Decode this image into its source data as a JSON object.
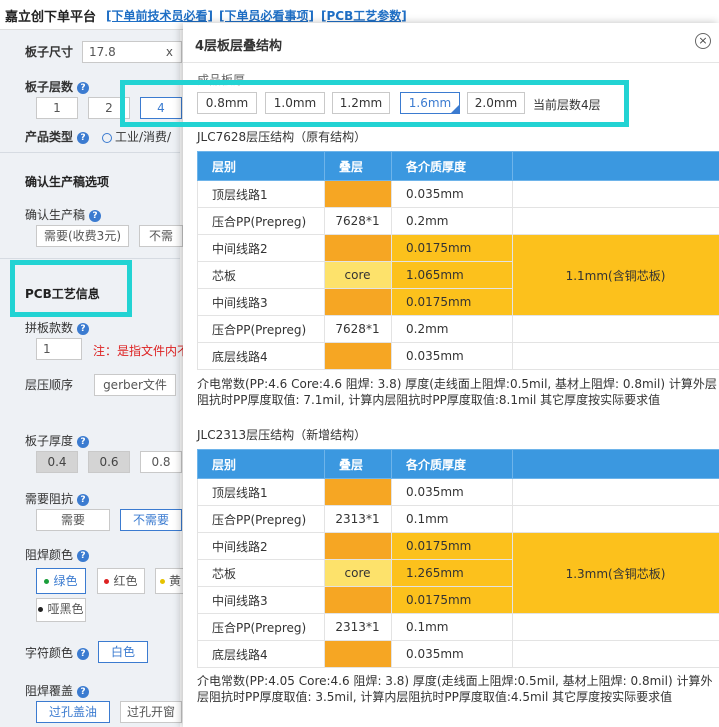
{
  "page": {
    "app_title": "嘉立创下单平台",
    "links": [
      "[下单前技术员必看]",
      "[下单员必看事项]",
      "[PCB工艺参数]"
    ]
  },
  "background": {
    "board_size_label": "板子尺寸",
    "board_size_value": "17.8",
    "board_size_x": "x",
    "layers_label": "板子层数",
    "layer_options": [
      "1",
      "2",
      "4"
    ],
    "product_type_label": "产品类型",
    "product_type_value": "工业/消费/",
    "confirm_section": "确认生产稿选项",
    "confirm_label": "确认生产稿",
    "confirm_options": [
      "需要(收费3元)",
      "不需"
    ],
    "pcb_section": "PCB工艺信息",
    "panel_label": "拼板款数",
    "panel_value": "1",
    "panel_note": "注：是指文件内不",
    "stack_order_label": "层压顺序",
    "stack_order_value": "gerber文件",
    "thickness_label": "板子厚度",
    "thickness_options": [
      "0.4",
      "0.6",
      "0.8"
    ],
    "impedance_label": "需要阻抗",
    "impedance_options": [
      "需要",
      "不需要"
    ],
    "mask_color_label": "阻焊颜色",
    "mask_colors": [
      {
        "label": "绿色",
        "color": "#1a9e3a"
      },
      {
        "label": "红色",
        "color": "#d22"
      },
      {
        "label": "黄",
        "color": "#e6c200"
      }
    ],
    "mask_color_extra": "哑黑色",
    "silk_color_label": "字符颜色",
    "silk_color_value": "白色",
    "mask_cover_label": "阻焊覆盖",
    "mask_cover_options": [
      "过孔盖油",
      "过孔开窗"
    ]
  },
  "modal": {
    "title": "4层板层叠结构",
    "close_icon": "close-icon",
    "finished_thickness_label": "成品板厚",
    "thickness_options": [
      "0.8mm",
      "1.0mm",
      "1.2mm",
      "1.6mm",
      "2.0mm"
    ],
    "selected_thickness": "1.6mm",
    "current_layers": "当前层数4层",
    "headers": [
      "层别",
      "叠层",
      "各介质厚度"
    ],
    "structures": [
      {
        "title": "JLC7628层压结构（原有结构）",
        "rows": [
          {
            "layer": "顶层线路1",
            "stack": "",
            "thickness": "0.035mm"
          },
          {
            "layer": "压合PP(Prepreg)",
            "stack": "7628*1",
            "thickness": "0.2mm"
          },
          {
            "layer": "中间线路2",
            "stack": "",
            "thickness": "0.0175mm"
          },
          {
            "layer": "芯板",
            "stack": "core",
            "thickness": "1.065mm"
          },
          {
            "layer": "中间线路3",
            "stack": "",
            "thickness": "0.0175mm"
          },
          {
            "layer": "压合PP(Prepreg)",
            "stack": "7628*1",
            "thickness": "0.2mm"
          },
          {
            "layer": "底层线路4",
            "stack": "",
            "thickness": "0.035mm"
          }
        ],
        "core_total": "1.1mm(含铜芯板)",
        "note": "介电常数(PP:4.6 Core:4.6 阻焊: 3.8) 厚度(走线面上阻焊:0.5mil, 基材上阻焊: 0.8mil) 计算外层阻抗时PP厚度取值: 7.1mil, 计算内层阻抗时PP厚度取值:8.1mil 其它厚度按实际要求值"
      },
      {
        "title": "JLC2313层压结构（新增结构）",
        "rows": [
          {
            "layer": "顶层线路1",
            "stack": "",
            "thickness": "0.035mm"
          },
          {
            "layer": "压合PP(Prepreg)",
            "stack": "2313*1",
            "thickness": "0.1mm"
          },
          {
            "layer": "中间线路2",
            "stack": "",
            "thickness": "0.0175mm"
          },
          {
            "layer": "芯板",
            "stack": "core",
            "thickness": "1.265mm"
          },
          {
            "layer": "中间线路3",
            "stack": "",
            "thickness": "0.0175mm"
          },
          {
            "layer": "压合PP(Prepreg)",
            "stack": "2313*1",
            "thickness": "0.1mm"
          },
          {
            "layer": "底层线路4",
            "stack": "",
            "thickness": "0.035mm"
          }
        ],
        "core_total": "1.3mm(含铜芯板)",
        "note": "介电常数(PP:4.05 Core:4.6 阻焊: 3.8) 厚度(走线面上阻焊:0.5mil, 基材上阻焊: 0.8mil) 计算外层阻抗时PP厚度取值: 3.5mil, 计算内层阻抗时PP厚度取值:4.5mil 其它厚度按实际要求值"
      }
    ]
  },
  "colors": {
    "header_blue": "#3b98e0",
    "copper_orange": "#f6a623",
    "core_gold": "#fcc11c",
    "core_yellow": "#fde26b",
    "highlight_cyan": "#22d3d3",
    "accent_blue": "#3b7bd0"
  }
}
